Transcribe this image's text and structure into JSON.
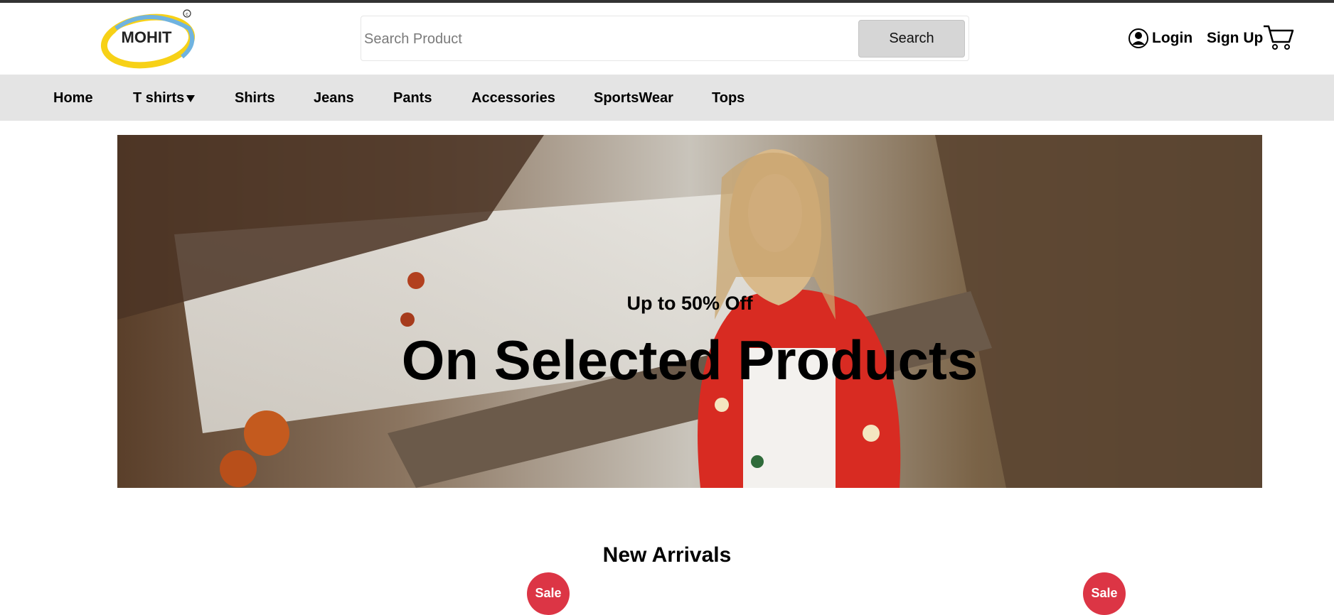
{
  "brand": {
    "logo_text": "MOHIT"
  },
  "search": {
    "placeholder": "Search Product",
    "value": "",
    "button_label": "Search"
  },
  "account": {
    "login_label": "Login",
    "signup_label": "Sign Up"
  },
  "nav": {
    "items": [
      {
        "label": "Home"
      },
      {
        "label": "T shirts",
        "has_dropdown": true
      },
      {
        "label": "Shirts"
      },
      {
        "label": "Jeans"
      },
      {
        "label": "Pants"
      },
      {
        "label": "Accessories"
      },
      {
        "label": "SportsWear"
      },
      {
        "label": "Tops"
      }
    ]
  },
  "hero": {
    "subheading": "Up to 50% Off",
    "heading": "On Selected Products"
  },
  "new_arrivals": {
    "title": "New Arrivals",
    "badges": [
      "Sale",
      "Sale"
    ]
  },
  "colors": {
    "sale_badge": "#dc3545",
    "nav_bar": "#e4e4e4",
    "search_button": "#d6d6d6"
  },
  "icons": {
    "login": "user-circle-icon",
    "cart": "shopping-cart-icon"
  }
}
